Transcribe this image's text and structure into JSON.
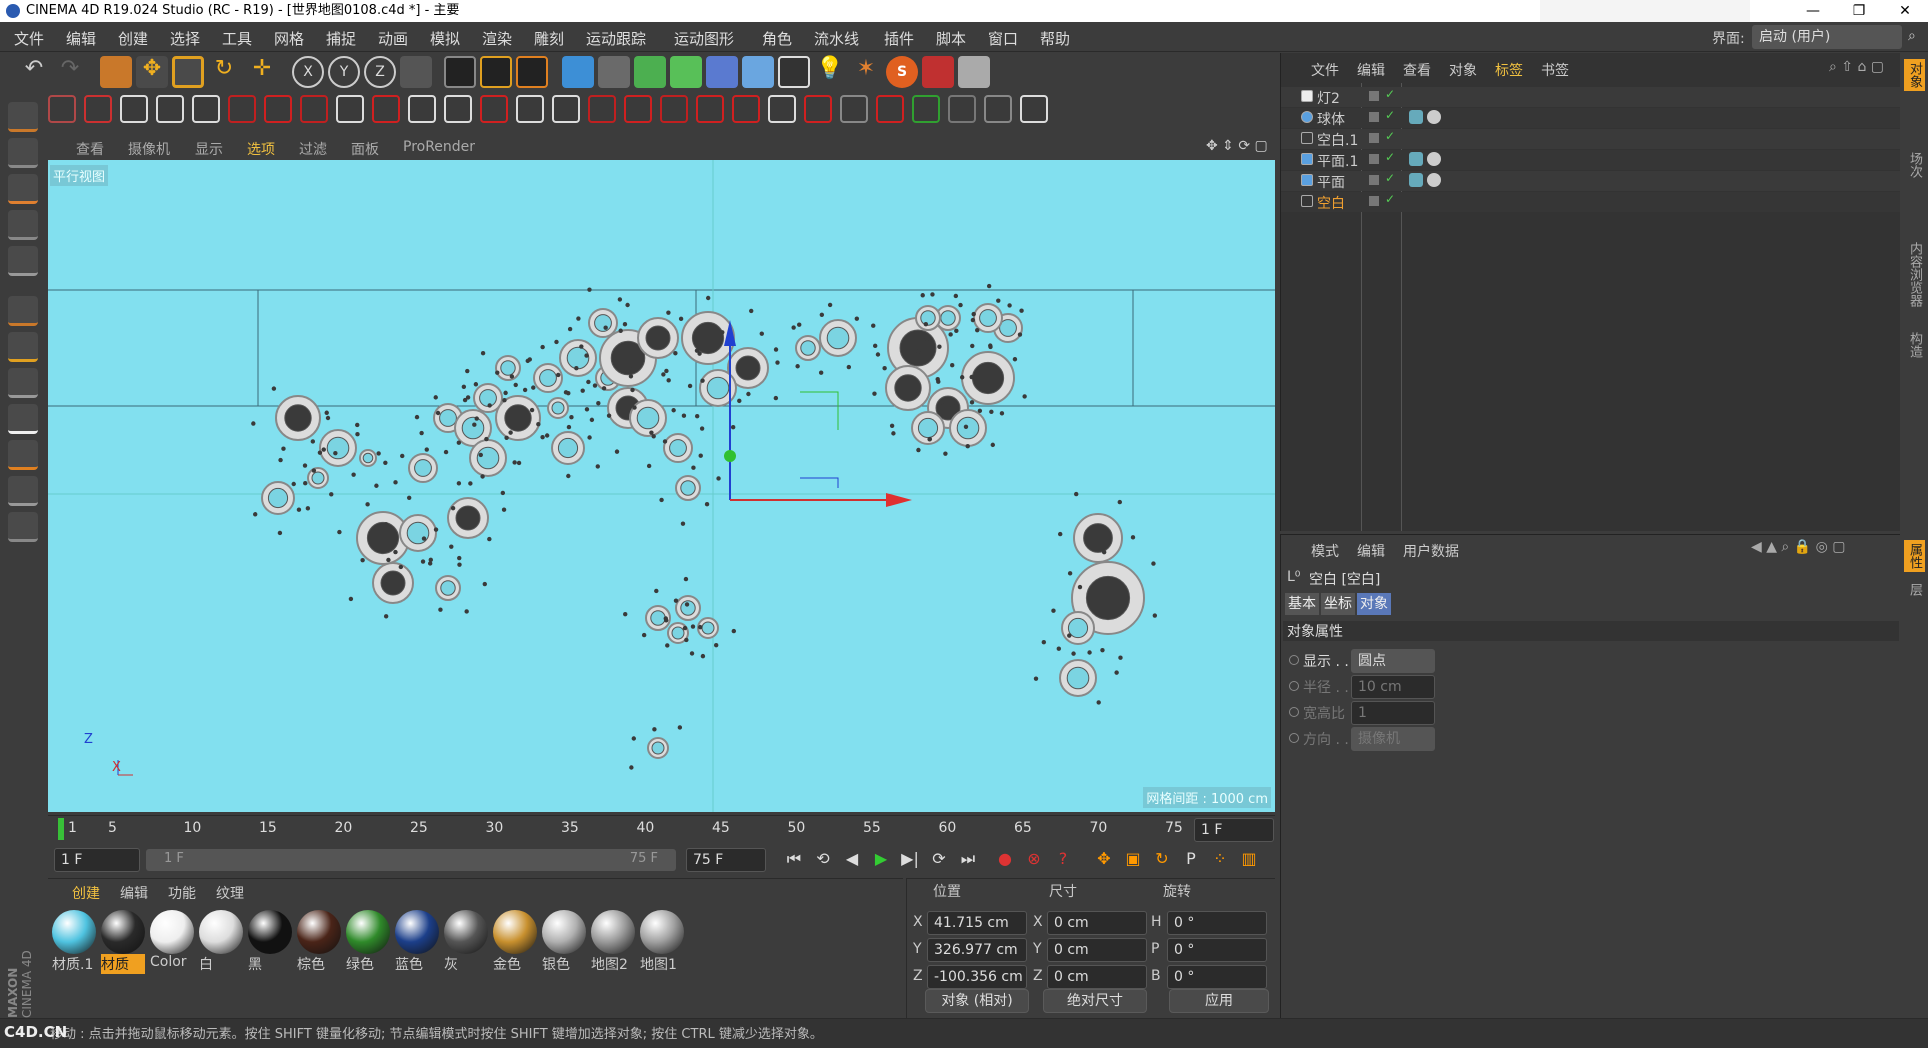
{
  "window": {
    "title": "CINEMA 4D R19.024 Studio (RC - R19) - [世界地图0108.c4d *] - 主要",
    "min": "—",
    "restore": "❐",
    "close": "✕"
  },
  "menu": [
    "文件",
    "编辑",
    "创建",
    "选择",
    "工具",
    "网格",
    "捕捉",
    "动画",
    "模拟",
    "渲染",
    "雕刻",
    "运动跟踪",
    "运动图形",
    "角色",
    "流水线",
    "插件",
    "脚本",
    "窗口",
    "帮助"
  ],
  "layout": {
    "label": "界面:",
    "value": "启动 (用户)"
  },
  "viewport": {
    "menu": [
      "查看",
      "摄像机",
      "显示",
      "选项",
      "过滤",
      "面板",
      "ProRender"
    ],
    "view_name": "平行视图",
    "grid_info": "网格间距 : 1000 cm",
    "axis_z": "Z",
    "axis_x": "X"
  },
  "object_manager": {
    "menu": [
      "文件",
      "编辑",
      "查看",
      "对象",
      "标签",
      "书签"
    ],
    "objects": [
      {
        "name": "灯2",
        "icon": "light-icon",
        "color": "#cccccc"
      },
      {
        "name": "球体",
        "icon": "sphere-icon",
        "color": "#cccccc"
      },
      {
        "name": "空白.1",
        "icon": "null-icon",
        "color": "#cccccc"
      },
      {
        "name": "平面.1",
        "icon": "plane-icon",
        "color": "#cccccc"
      },
      {
        "name": "平面",
        "icon": "plane-icon",
        "color": "#cccccc"
      },
      {
        "name": "空白",
        "icon": "null-icon",
        "color": "#f0a030"
      }
    ]
  },
  "attributes": {
    "menu": [
      "模式",
      "编辑",
      "用户数据"
    ],
    "object_title": "空白 [空白]",
    "tabs": [
      "基本",
      "坐标",
      "对象"
    ],
    "section": "对象属性",
    "fields": [
      {
        "label": "显示 . .",
        "value": "圆点"
      },
      {
        "label": "半径 . .",
        "value": "10 cm"
      },
      {
        "label": "宽高比",
        "value": "1"
      },
      {
        "label": "方向 . .",
        "value": "摄像机"
      }
    ]
  },
  "side_tabs": [
    "对象",
    "场次",
    "内容浏览器",
    "构造"
  ],
  "side_tabs2": [
    "属性",
    "层"
  ],
  "timeline": {
    "ticks": [
      "5",
      "10",
      "15",
      "20",
      "25",
      "30",
      "35",
      "40",
      "45",
      "50",
      "55",
      "60",
      "65",
      "70",
      "75"
    ],
    "start": "1",
    "current": "1 F",
    "frame_field": "1 F",
    "range_start": "1 F",
    "range_end": "75 F",
    "end_field": "75 F"
  },
  "materials": {
    "menu": [
      "创建",
      "编辑",
      "功能",
      "纹理"
    ],
    "items": [
      {
        "name": "材质.1",
        "color": "#4fc3e0"
      },
      {
        "name": "材质",
        "color": "#2a2a2a"
      },
      {
        "name": "Color",
        "color": "#eeeeee"
      },
      {
        "name": "白",
        "color": "#dddddd"
      },
      {
        "name": "黑",
        "color": "#111111"
      },
      {
        "name": "棕色",
        "color": "#4a2418"
      },
      {
        "name": "绿色",
        "color": "#2f8a2a"
      },
      {
        "name": "蓝色",
        "color": "#1c3f8a"
      },
      {
        "name": "灰",
        "color": "#555555"
      },
      {
        "name": "金色",
        "color": "#c8902e"
      },
      {
        "name": "银色",
        "color": "#b0b0b0"
      },
      {
        "name": "地图2",
        "color": "#9a9a9a"
      },
      {
        "name": "地图1",
        "color": "#a0a0a0"
      }
    ]
  },
  "coords": {
    "headers": [
      "位置",
      "尺寸",
      "旋转"
    ],
    "rows": [
      {
        "axis": "X",
        "pos": "41.715 cm",
        "saxis": "X",
        "size": "0 cm",
        "raxis": "H",
        "rot": "0 °"
      },
      {
        "axis": "Y",
        "pos": "326.977 cm",
        "saxis": "Y",
        "size": "0 cm",
        "raxis": "P",
        "rot": "0 °"
      },
      {
        "axis": "Z",
        "pos": "-100.356 cm",
        "saxis": "Z",
        "size": "0 cm",
        "raxis": "B",
        "rot": "0 °"
      }
    ],
    "mode1": "对象 (相对)",
    "mode2": "绝对尺寸",
    "apply": "应用"
  },
  "status": {
    "text": "移动 : 点击并拖动鼠标移动元素。按住 SHIFT 键量化移动; 节点编辑模式时按住 SHIFT 键增加选择对象; 按住 CTRL 键减少选择对象。",
    "watermark": "C4D.CN"
  },
  "logo": {
    "brand": "MAXON",
    "product": "CINEMA 4D"
  }
}
